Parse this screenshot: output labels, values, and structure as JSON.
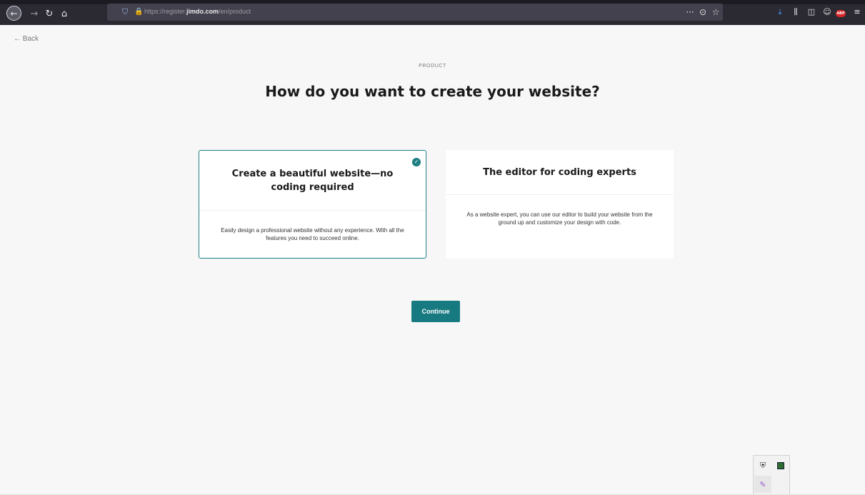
{
  "browser": {
    "url_prefix": "https://register.",
    "url_domain": "jimdo.com",
    "url_path": "/en/product",
    "icons": {
      "back": "←",
      "forward": "→",
      "reload": "↻",
      "home": "⌂",
      "shield": "⛉",
      "lock": "🔒",
      "more": "···",
      "pocket": "⊙",
      "star": "☆",
      "download": "⤓",
      "library": "⫼",
      "sidebar": "◫",
      "account": "☺",
      "abp": "ABP",
      "menu": "≡"
    }
  },
  "page": {
    "back_label": "← Back",
    "eyebrow": "PRODUCT",
    "title": "How do you want to create your website?",
    "continue_label": "Continue"
  },
  "options": [
    {
      "title": "Create a beautiful website—no coding required",
      "description": "Easily design a professional website without any experience. With all the features you need to succeed online.",
      "selected": true
    },
    {
      "title": "The editor for coding experts",
      "description": "As a website expert, you can use our editor to build your website from the ground up and customize your design with code.",
      "selected": false
    }
  ],
  "check_glyph": "✓",
  "extensions": {
    "icon1": "⛨",
    "icon3": "✎"
  },
  "colors": {
    "accent": "#177a80",
    "selected_border": "#1e7e82",
    "page_bg": "#f7f7f7",
    "browser_bg": "#2b2a33"
  }
}
